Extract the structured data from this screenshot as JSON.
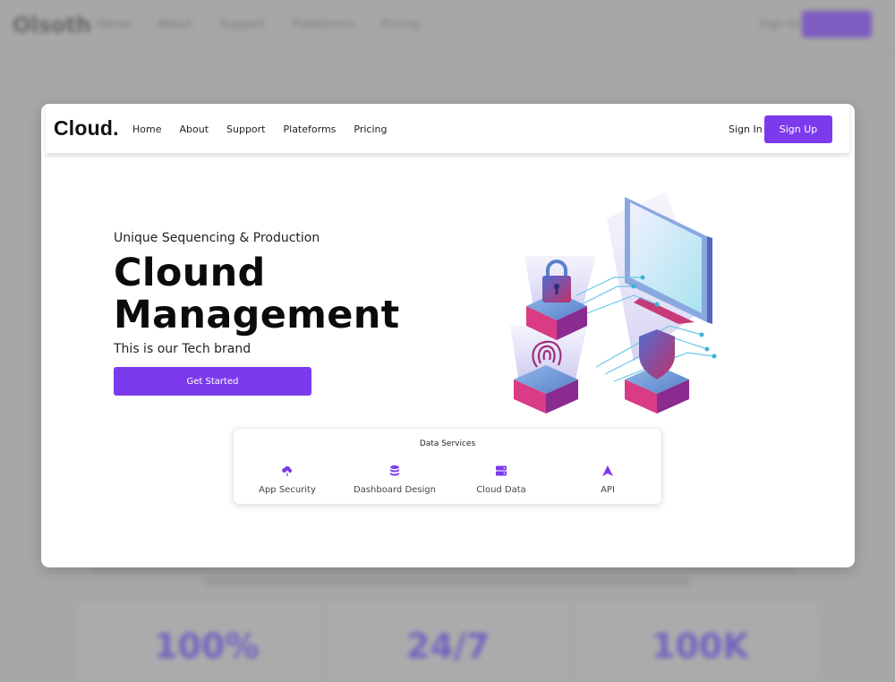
{
  "background_page": {
    "nav_links": [
      "Home",
      "About",
      "Support",
      "Plateforms",
      "Pricing"
    ],
    "sign_in": "Sign In",
    "stats": [
      "100%",
      "24/7",
      "100K"
    ]
  },
  "header": {
    "logo": "Cloud.",
    "nav": [
      "Home",
      "About",
      "Support",
      "Plateforms",
      "Pricing"
    ],
    "sign_in": "Sign In",
    "sign_up": "Sign Up"
  },
  "hero": {
    "subtitle": "Unique Sequencing & Production",
    "title_line1": "Clound",
    "title_line2": "Management",
    "tagline": "This is our Tech brand",
    "cta": "Get Started"
  },
  "services": {
    "title": "Data Services",
    "items": [
      {
        "label": "App Security",
        "icon": "cloud-upload-icon"
      },
      {
        "label": "Dashboard Design",
        "icon": "database-icon"
      },
      {
        "label": "Cloud Data",
        "icon": "server-icon"
      },
      {
        "label": "API",
        "icon": "api-triangle-icon"
      }
    ]
  },
  "colors": {
    "accent": "#7c3aed",
    "overlay": "#a7a7a7"
  }
}
